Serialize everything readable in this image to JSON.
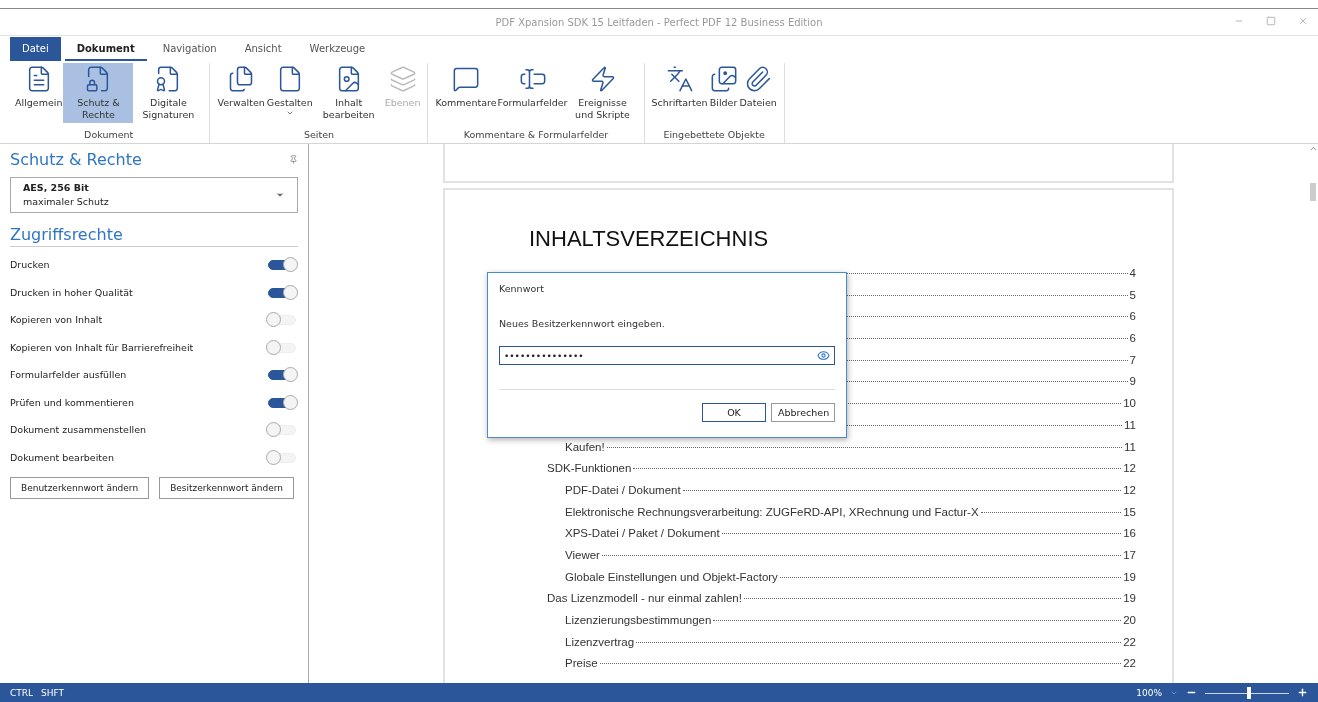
{
  "window": {
    "title": "PDF Xpansion SDK 15 Leitfaden - Perfect PDF 12 Business Edition"
  },
  "tabs": [
    {
      "label": "Datei",
      "kind": "file",
      "selected": false
    },
    {
      "label": "Dokument",
      "kind": "tab",
      "selected": true
    },
    {
      "label": "Navigation",
      "kind": "tab",
      "selected": false
    },
    {
      "label": "Ansicht",
      "kind": "tab",
      "selected": false
    },
    {
      "label": "Werkzeuge",
      "kind": "tab",
      "selected": false
    }
  ],
  "ribbon": [
    {
      "label": "Dokument",
      "buttons": [
        {
          "label": "Allgemein",
          "selected": false,
          "disabled": false
        },
        {
          "label": "Schutz & Rechte",
          "selected": true,
          "disabled": false
        },
        {
          "label": "Digitale Signaturen",
          "selected": false,
          "disabled": false
        }
      ]
    },
    {
      "label": "Seiten",
      "buttons": [
        {
          "label": "Verwalten",
          "selected": false,
          "disabled": false
        },
        {
          "label": "Gestalten",
          "selected": false,
          "disabled": false,
          "dropdown": true
        },
        {
          "label": "Inhalt bearbeiten",
          "selected": false,
          "disabled": false
        },
        {
          "label": "Ebenen",
          "selected": false,
          "disabled": true
        }
      ]
    },
    {
      "label": "Kommentare & Formularfelder",
      "buttons": [
        {
          "label": "Kommentare",
          "selected": false,
          "disabled": false
        },
        {
          "label": "Formularfelder",
          "selected": false,
          "disabled": false
        },
        {
          "label": "Ereignisse und Skripte",
          "selected": false,
          "disabled": false
        }
      ]
    },
    {
      "label": "Eingebettete Objekte",
      "buttons": [
        {
          "label": "Schriftarten",
          "selected": false,
          "disabled": false
        },
        {
          "label": "Bilder",
          "selected": false,
          "disabled": false
        },
        {
          "label": "Dateien",
          "selected": false,
          "disabled": false
        }
      ]
    }
  ],
  "panel": {
    "title": "Schutz & Rechte",
    "encryption": {
      "value": "AES, 256 Bit",
      "detail": "maximaler Schutz"
    },
    "section": "Zugriffsrechte",
    "permissions": [
      {
        "label": "Drucken",
        "on": true
      },
      {
        "label": "Drucken in hoher Qualität",
        "on": true
      },
      {
        "label": "Kopieren von Inhalt",
        "on": false
      },
      {
        "label": "Kopieren von Inhalt für Barrierefreiheit",
        "on": false
      },
      {
        "label": "Formularfelder ausfüllen",
        "on": true
      },
      {
        "label": "Prüfen und kommentieren",
        "on": true
      },
      {
        "label": "Dokument zusammenstellen",
        "on": false
      },
      {
        "label": "Dokument bearbeiten",
        "on": false
      }
    ],
    "buttons": [
      "Benutzerkennwort ändern",
      "Besitzerkennwort ändern"
    ]
  },
  "document": {
    "heading": "INHALTSVERZEICHNIS",
    "toc": [
      {
        "page": "4",
        "children": [
          {
            "page": "5"
          },
          {
            "page": "6"
          },
          {
            "page": "6"
          },
          {
            "page": "7"
          },
          {
            "page": "9"
          },
          {
            "page": "10"
          },
          {
            "page": "11",
            "children": [
              {
                "title": "Kaufen!",
                "page": "11"
              }
            ]
          },
          {
            "title": "SDK-Funktionen",
            "page": "12",
            "children": [
              {
                "title": "PDF-Datei / Dokument",
                "page": "12"
              },
              {
                "title": "Elektronische Rechnungsverarbeitung: ZUGFeRD-API, XRechnung und Factur-X",
                "page": "15"
              },
              {
                "title": "XPS-Datei / Paket / Dokument",
                "page": "16"
              },
              {
                "title": "Viewer",
                "page": "17"
              },
              {
                "title": "Globale Einstellungen und Objekt-Factory",
                "page": "19"
              }
            ]
          },
          {
            "title": "Das Lizenzmodell - nur einmal zahlen!",
            "page": "19",
            "children": [
              {
                "title": "Lizenzierungsbestimmungen",
                "page": "20"
              },
              {
                "title": "Lizenzvertrag",
                "page": "22"
              },
              {
                "title": "Preise",
                "page": "22"
              }
            ]
          }
        ]
      }
    ]
  },
  "dialog": {
    "title": "Kennwort",
    "prompt": "Neues Besitzerkennwort eingeben.",
    "value": "•••••••••••••••",
    "buttons": [
      "OK",
      "Abbrechen"
    ]
  },
  "status_bar": {
    "keys": [
      "CTRL",
      "SHFT"
    ],
    "zoom": "100%",
    "zoom_slider": {
      "level": 0.52
    }
  }
}
